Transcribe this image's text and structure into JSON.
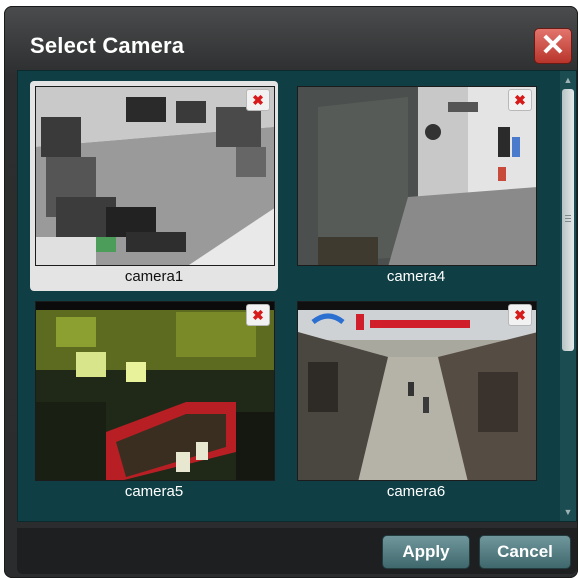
{
  "dialog": {
    "title": "Select Camera",
    "close_glyph": "✕"
  },
  "cameras": [
    {
      "label": "camera1",
      "selected": true
    },
    {
      "label": "camera4",
      "selected": false
    },
    {
      "label": "camera5",
      "selected": false
    },
    {
      "label": "camera6",
      "selected": false
    }
  ],
  "tile_remove_glyph": "✖",
  "buttons": {
    "apply": "Apply",
    "cancel": "Cancel"
  },
  "icons": {
    "close": "close-icon",
    "remove": "remove-icon",
    "scroll_up": "scroll-up-icon",
    "scroll_down": "scroll-down-icon"
  },
  "colors": {
    "panel": "#0f3f44",
    "close_button": "#c9473d",
    "primary_button": "#54797e"
  }
}
